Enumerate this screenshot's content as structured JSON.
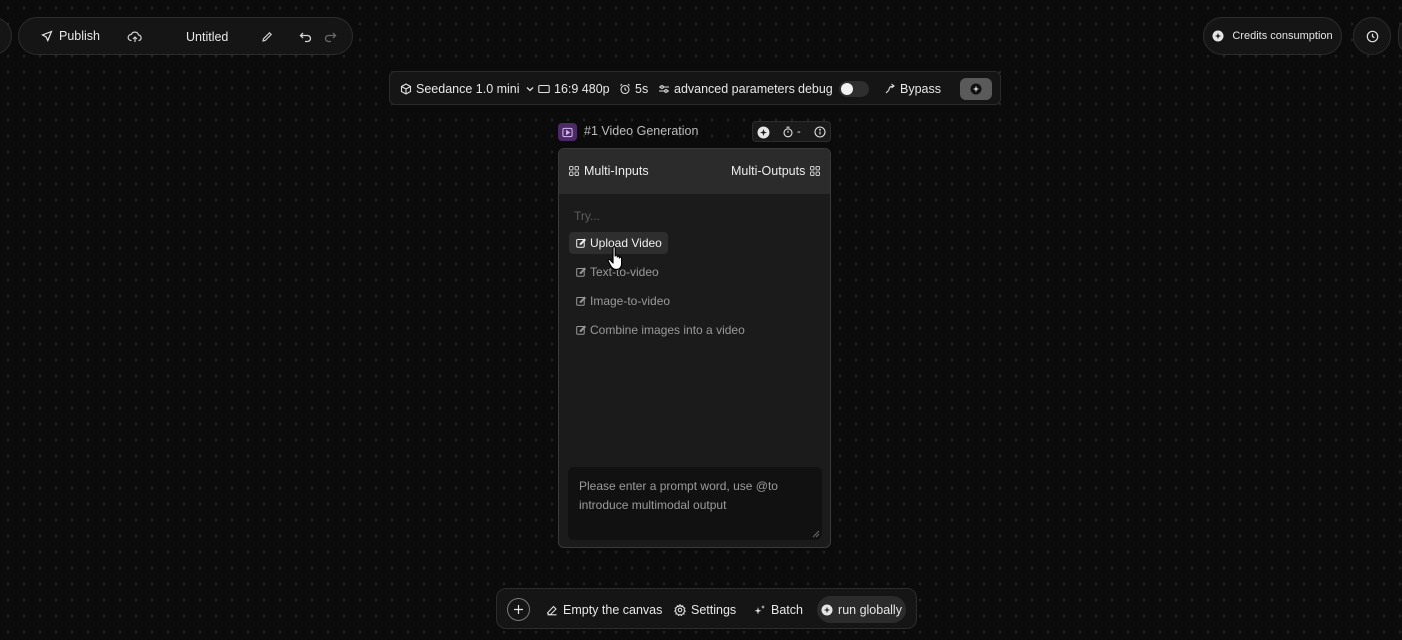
{
  "toolbar": {
    "publish_label": "Publish",
    "doc_title": "Untitled"
  },
  "top_right": {
    "credits_label": "Credits consumption"
  },
  "params": {
    "model": "Seedance 1.0 mini",
    "ratio": "16:9 480p",
    "duration": "5s",
    "advanced": "advanced parameters",
    "debug": "debug",
    "bypass": "Bypass"
  },
  "node": {
    "title": "#1 Video Generation",
    "timer_value": "-",
    "inputs_label": "Multi-Inputs",
    "outputs_label": "Multi-Outputs",
    "try_label": "Try...",
    "suggestions": [
      "Upload Video",
      "Text-to-video",
      "Image-to-video",
      "Combine images into a video"
    ],
    "prompt_placeholder": "Please enter a prompt word, use @to introduce multimodal output"
  },
  "bottom": {
    "empty_label": "Empty the canvas",
    "settings_label": "Settings",
    "batch_label": "Batch",
    "run_label": "run globally"
  },
  "colors": {
    "background": "#0b0b0b",
    "panel": "#151515",
    "node_badge": "#4b2a66"
  }
}
